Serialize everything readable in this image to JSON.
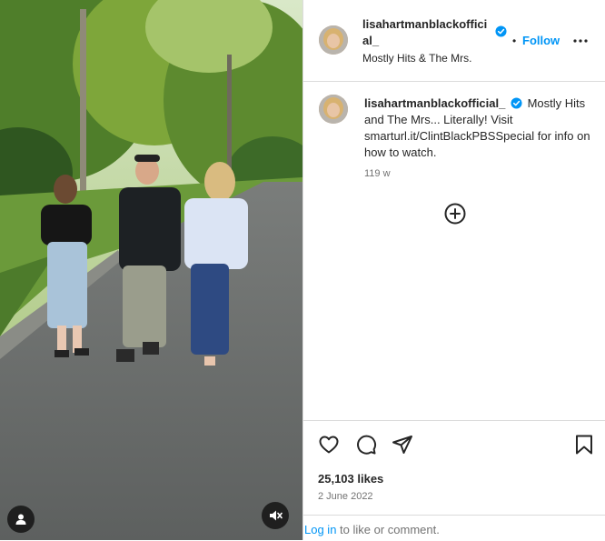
{
  "post": {
    "username": "lisahartmanblackofficial_",
    "username_line1": "lisahartmanblackoffici",
    "username_line2": "al_",
    "audio": "Mostly Hits & The Mrs.",
    "follow_label": "Follow",
    "separator": "•",
    "caption_text": "Mostly Hits and The Mrs... Literally! Visit smarturl.it/ClintBlackPBSSpecial for info on how to watch.",
    "caption_age": "119 w",
    "likes": "25,103 likes",
    "date": "2 June 2022"
  },
  "footer": {
    "login_link": "Log in",
    "login_rest": " to like or comment."
  },
  "icons": {
    "verified": "verified-badge-icon",
    "more": "more-options-icon",
    "add": "plus-circle-icon",
    "like": "heart-icon",
    "comment": "comment-icon",
    "share": "share-icon",
    "save": "bookmark-icon",
    "tagged": "user-tag-icon",
    "mute": "muted-audio-icon"
  },
  "colors": {
    "accent": "#0095f6",
    "verified": "#0095f6",
    "text": "#262626",
    "muted": "#737373"
  }
}
